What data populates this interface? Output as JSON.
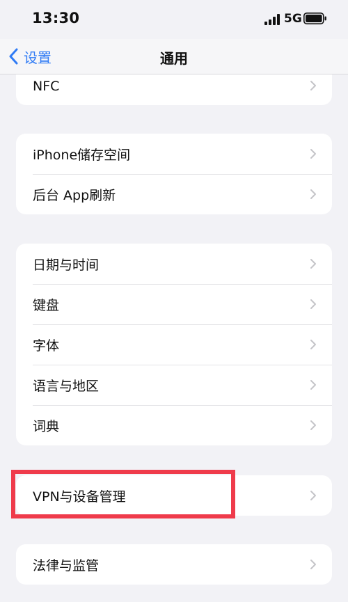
{
  "status": {
    "time": "13:30",
    "network": "5G"
  },
  "nav": {
    "back_label": "设置",
    "title": "通用"
  },
  "groups": [
    {
      "items": [
        {
          "label": "NFC"
        }
      ]
    },
    {
      "items": [
        {
          "label": "iPhone储存空间"
        },
        {
          "label": "后台 App刷新"
        }
      ]
    },
    {
      "items": [
        {
          "label": "日期与时间"
        },
        {
          "label": "键盘"
        },
        {
          "label": "字体"
        },
        {
          "label": "语言与地区"
        },
        {
          "label": "词典"
        }
      ]
    },
    {
      "items": [
        {
          "label": "VPN与设备管理"
        }
      ]
    },
    {
      "items": [
        {
          "label": "法律与监管"
        }
      ]
    }
  ],
  "colors": {
    "accent": "#2f7bf5",
    "highlight_border": "#ef3b4b",
    "background": "#f2f2f6"
  }
}
